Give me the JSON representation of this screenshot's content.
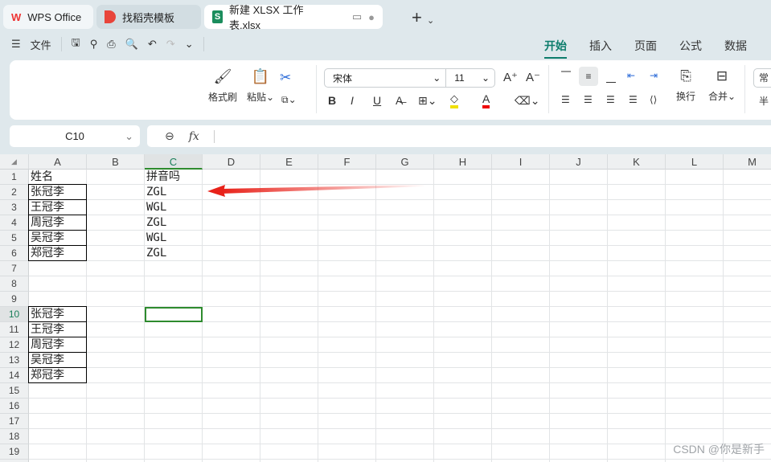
{
  "tabs": [
    {
      "label": "WPS Office",
      "icon": "wps-logo-icon"
    },
    {
      "label": "找稻壳模板",
      "icon": "docer-icon"
    },
    {
      "label": "新建 XLSX 工作表.xlsx",
      "icon": "spreadsheet-icon"
    }
  ],
  "menu": {
    "file": "文件"
  },
  "ribbon_tabs": [
    "开始",
    "插入",
    "页面",
    "公式",
    "数据"
  ],
  "ribbon": {
    "format_painter": "格式刷",
    "paste": "粘贴",
    "font": "宋体",
    "size": "11",
    "wrap": "换行",
    "merge": "合并",
    "style_partial": "常",
    "half": "半"
  },
  "formula_bar": {
    "cell_ref": "C10",
    "fx": "fx",
    "value": ""
  },
  "columns": [
    "A",
    "B",
    "C",
    "D",
    "E",
    "F",
    "G",
    "H",
    "I",
    "J",
    "K",
    "L",
    "M"
  ],
  "selected": {
    "col": "C",
    "row": 10
  },
  "rows": {
    "1": {
      "A": "姓名",
      "C": "拼音吗"
    },
    "2": {
      "A": "张冠李",
      "C": "ZGL"
    },
    "3": {
      "A": "王冠李",
      "C": "WGL"
    },
    "4": {
      "A": "周冠李",
      "C": "ZGL"
    },
    "5": {
      "A": "吴冠李",
      "C": "WGL"
    },
    "6": {
      "A": "郑冠李",
      "C": "ZGL"
    },
    "10": {
      "A": "张冠李"
    },
    "11": {
      "A": "王冠李"
    },
    "12": {
      "A": "周冠李"
    },
    "13": {
      "A": "吴冠李"
    },
    "14": {
      "A": "郑冠李"
    }
  },
  "bordered": [
    "A2",
    "A3",
    "A4",
    "A5",
    "A6",
    "A10",
    "A11",
    "A12",
    "A13",
    "A14"
  ],
  "annotation": {
    "arrow_color": "#e8221a"
  },
  "watermark": "CSDN @你是新手"
}
